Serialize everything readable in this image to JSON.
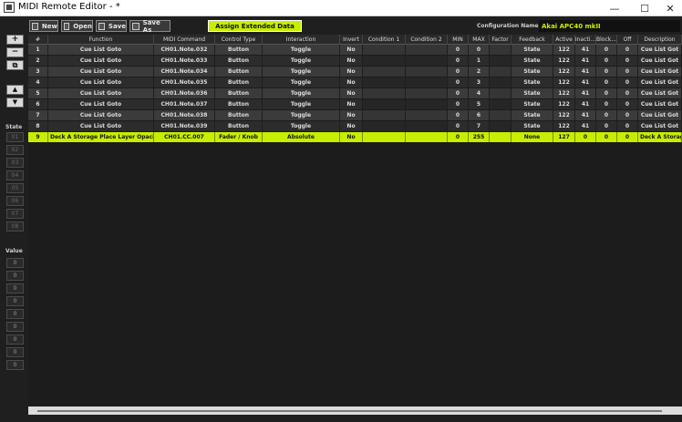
{
  "window": {
    "title": "MIDI Remote Editor - *",
    "minimize": "—",
    "maximize": "☐",
    "close": "✕"
  },
  "toolbar": {
    "new_label": "New",
    "open_label": "Open",
    "save_label": "Save",
    "save_as_label": "Save As",
    "assign_label": "Assign Extended Data",
    "config_label": "Configuration Name :",
    "config_value": "Akai APC40 mkII"
  },
  "side": {
    "add": "+",
    "remove": "−",
    "duplicate": "⧉",
    "up": "▲",
    "down": "▼",
    "state_label": "State",
    "states": [
      "01",
      "02",
      "03",
      "04",
      "05",
      "06",
      "07",
      "08"
    ],
    "value_label": "Value",
    "values": [
      "0",
      "0",
      "0",
      "0",
      "0",
      "0",
      "0",
      "0",
      "0"
    ]
  },
  "table": {
    "headers": [
      "#",
      "Function",
      "MIDI Command",
      "Control Type",
      "Interaction",
      "Invert",
      "Condition 1",
      "Condition 2",
      "MIN",
      "MAX",
      "Factor",
      "Feedback",
      "Active",
      "Inacti...",
      "Block...",
      "Off",
      "Description"
    ],
    "rows": [
      [
        "1",
        "Cue List Goto",
        "CH01.Note.032",
        "Button",
        "Toggle",
        "No",
        "",
        "",
        "0",
        "0",
        "",
        "State",
        "122",
        "41",
        "0",
        "0",
        "Cue List Got"
      ],
      [
        "2",
        "Cue List Goto",
        "CH01.Note.033",
        "Button",
        "Toggle",
        "No",
        "",
        "",
        "0",
        "1",
        "",
        "State",
        "122",
        "41",
        "0",
        "0",
        "Cue List Got"
      ],
      [
        "3",
        "Cue List Goto",
        "CH01.Note.034",
        "Button",
        "Toggle",
        "No",
        "",
        "",
        "0",
        "2",
        "",
        "State",
        "122",
        "41",
        "0",
        "0",
        "Cue List Got"
      ],
      [
        "4",
        "Cue List Goto",
        "CH01.Note.035",
        "Button",
        "Toggle",
        "No",
        "",
        "",
        "0",
        "3",
        "",
        "State",
        "122",
        "41",
        "0",
        "0",
        "Cue List Got"
      ],
      [
        "5",
        "Cue List Goto",
        "CH01.Note.036",
        "Button",
        "Toggle",
        "No",
        "",
        "",
        "0",
        "4",
        "",
        "State",
        "122",
        "41",
        "0",
        "0",
        "Cue List Got"
      ],
      [
        "6",
        "Cue List Goto",
        "CH01.Note.037",
        "Button",
        "Toggle",
        "No",
        "",
        "",
        "0",
        "5",
        "",
        "State",
        "122",
        "41",
        "0",
        "0",
        "Cue List Got"
      ],
      [
        "7",
        "Cue List Goto",
        "CH01.Note.038",
        "Button",
        "Toggle",
        "No",
        "",
        "",
        "0",
        "6",
        "",
        "State",
        "122",
        "41",
        "0",
        "0",
        "Cue List Got"
      ],
      [
        "8",
        "Cue List Goto",
        "CH01.Note.039",
        "Button",
        "Toggle",
        "No",
        "",
        "",
        "0",
        "7",
        "",
        "State",
        "122",
        "41",
        "0",
        "0",
        "Cue List Got"
      ],
      [
        "9",
        "Deck A Storage Place Layer Opacity L...",
        "CH01.CC.007",
        "Fader / Knob",
        "Absolute",
        "No",
        "",
        "",
        "0",
        "255",
        "",
        "None",
        "127",
        "0",
        "0",
        "0",
        "Deck A Storage Place Lay"
      ]
    ],
    "selected_row": 8
  },
  "colors": {
    "accent": "#c6ee00",
    "background": "#1f1f1f"
  }
}
